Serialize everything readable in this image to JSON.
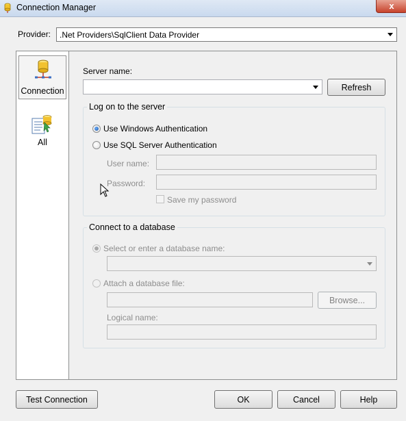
{
  "window": {
    "title": "Connection Manager",
    "close_glyph": "x"
  },
  "provider": {
    "label": "Provider:",
    "value": ".Net Providers\\SqlClient Data Provider"
  },
  "nav": {
    "items": [
      {
        "label": "Connection",
        "icon": "database-connection-icon",
        "selected": true
      },
      {
        "label": "All",
        "icon": "all-properties-icon",
        "selected": false
      }
    ]
  },
  "server": {
    "label": "Server name:",
    "value": "",
    "refresh_label": "Refresh"
  },
  "logon": {
    "title": "Log on to the server",
    "windows_auth_label": "Use Windows Authentication",
    "sql_auth_label": "Use SQL Server Authentication",
    "windows_auth_selected": true,
    "username_label": "User name:",
    "username_value": "",
    "password_label": "Password:",
    "password_value": "",
    "save_password_label": "Save my password",
    "save_password_checked": false
  },
  "database": {
    "title": "Connect to a database",
    "select_label": "Select or enter a database name:",
    "select_value": "",
    "attach_label": "Attach a database file:",
    "attach_value": "",
    "browse_label": "Browse...",
    "logical_name_label": "Logical name:",
    "logical_name_value": ""
  },
  "footer": {
    "test_connection_label": "Test Connection",
    "ok_label": "OK",
    "cancel_label": "Cancel",
    "help_label": "Help"
  },
  "colors": {
    "window_bg": "#f0f0f0",
    "close_button": "#c7432c",
    "radio_selected": "#1a4f9c",
    "disabled_text": "#8d8d8d"
  }
}
